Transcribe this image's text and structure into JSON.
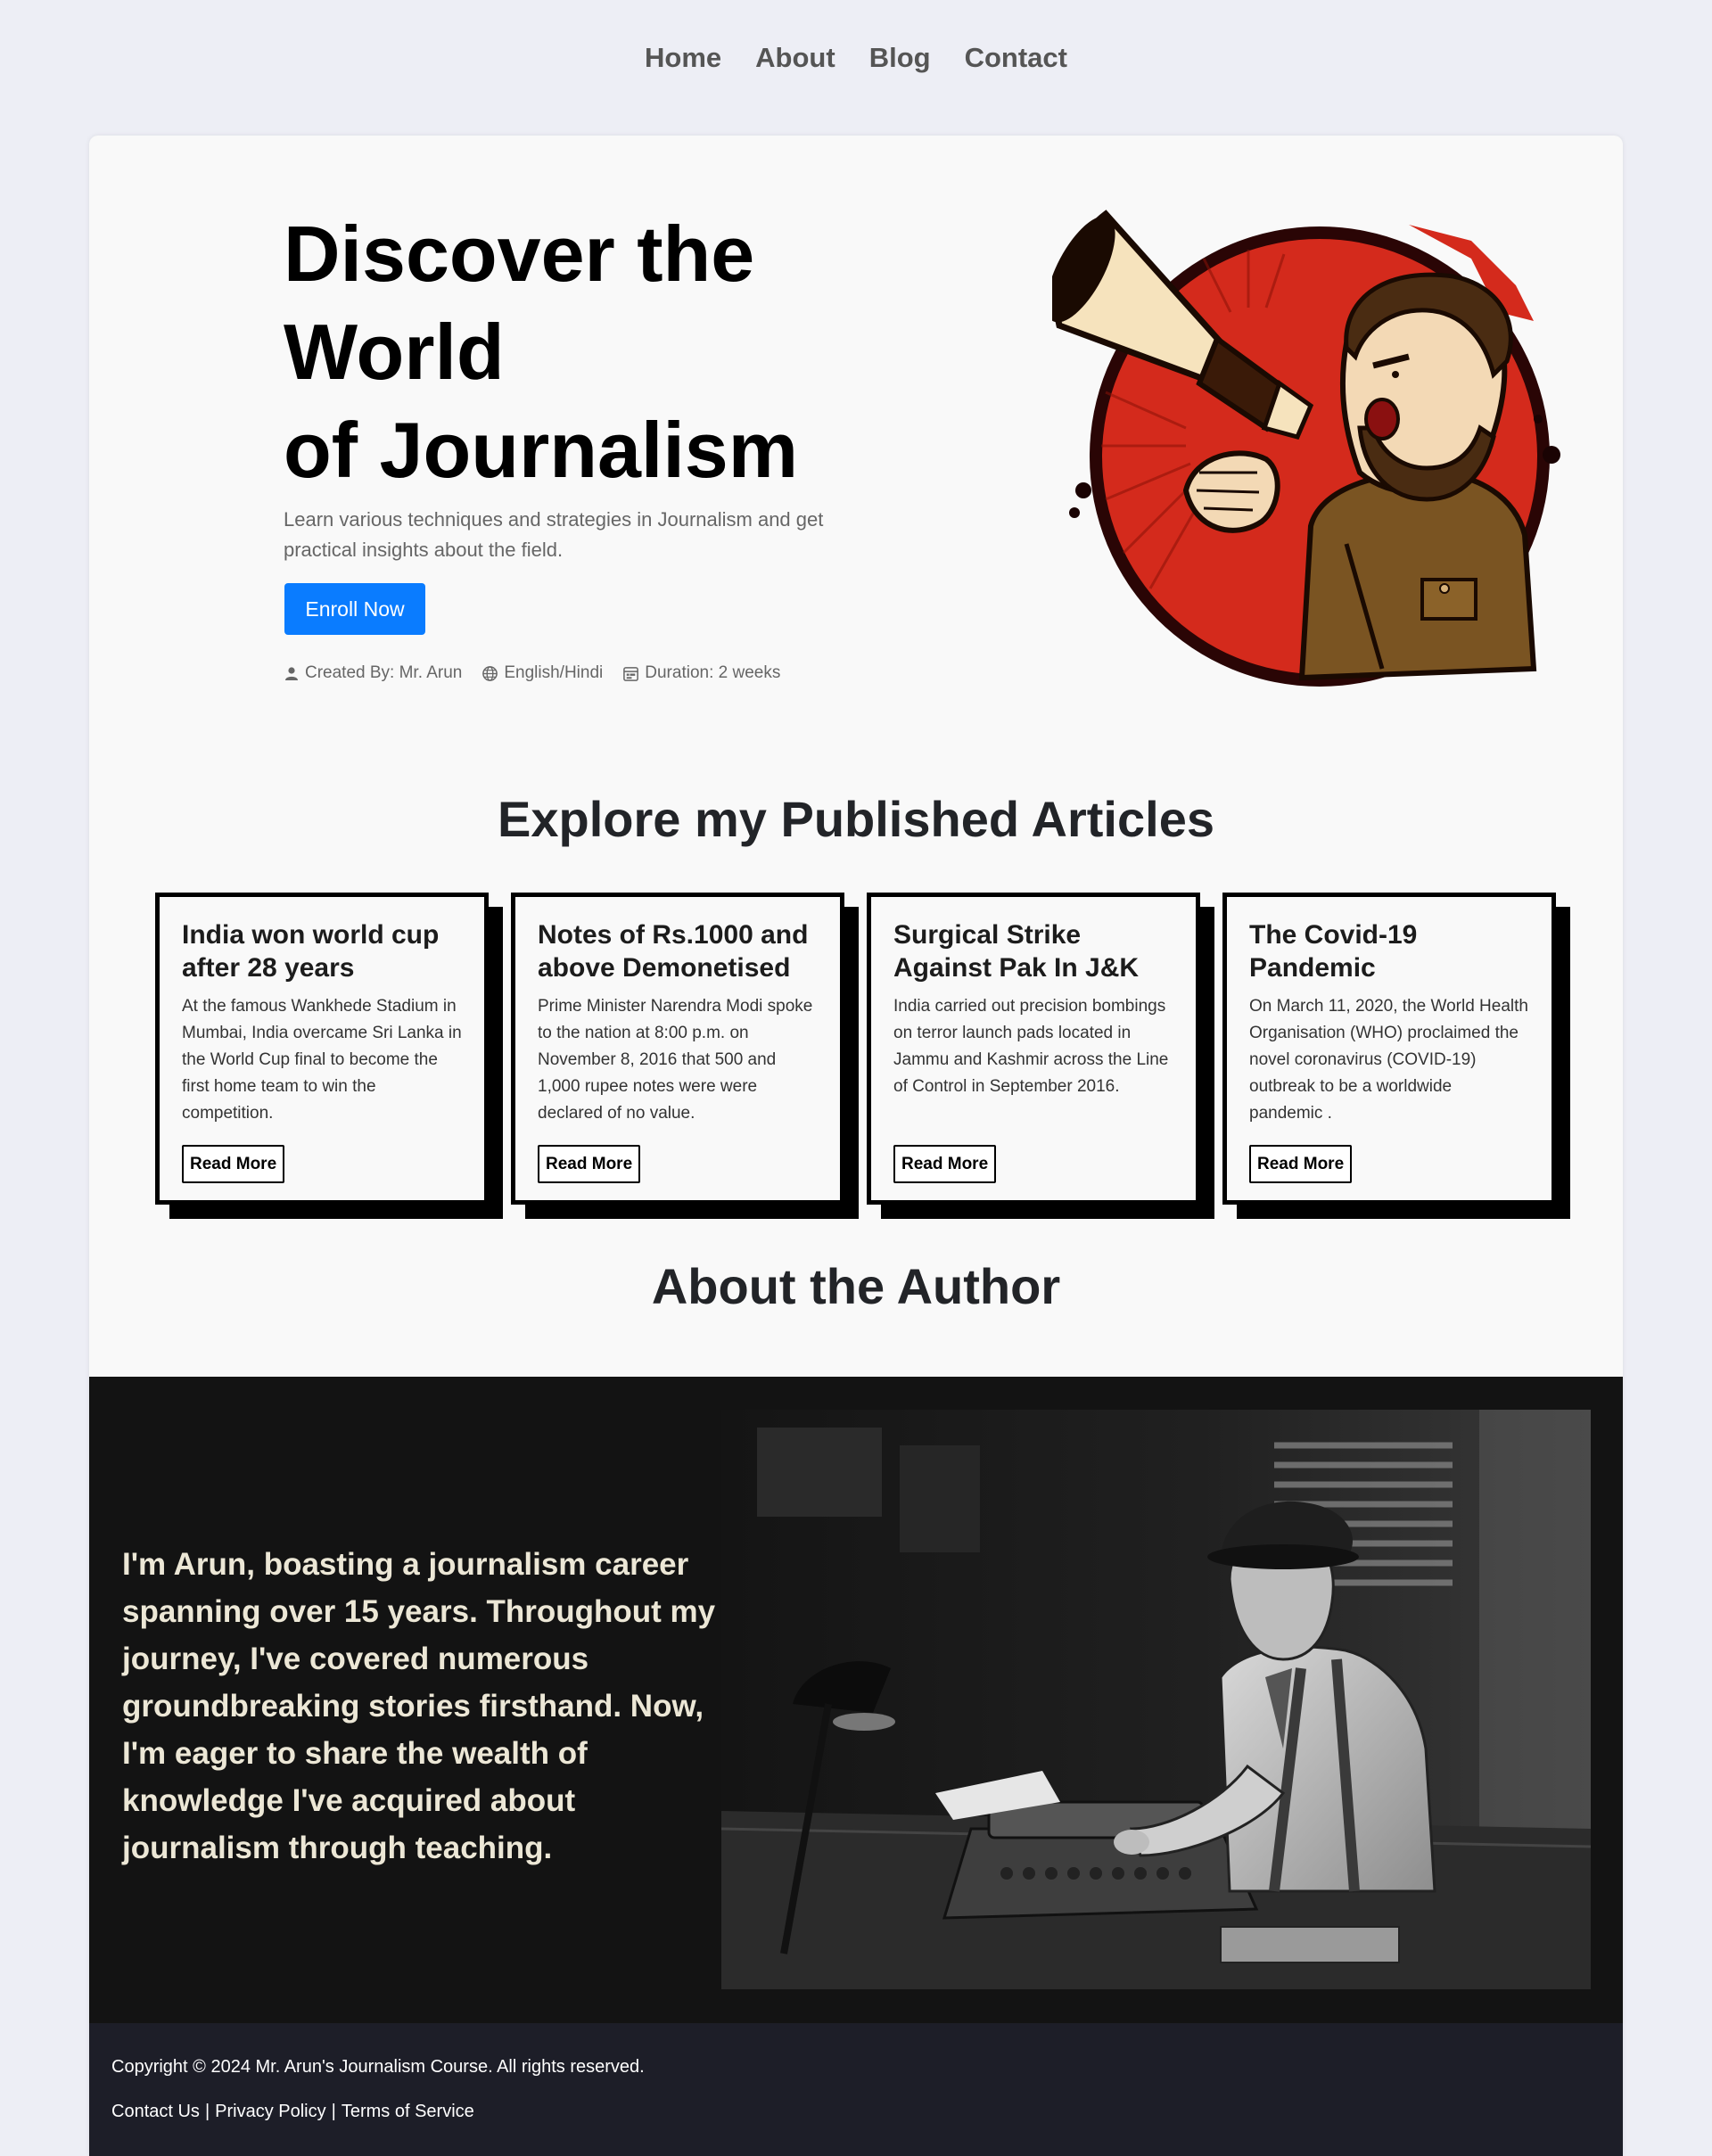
{
  "nav": {
    "items": [
      {
        "label": "Home"
      },
      {
        "label": "About"
      },
      {
        "label": "Blog"
      },
      {
        "label": "Contact"
      }
    ]
  },
  "hero": {
    "title_lines": [
      "Discover the",
      "World",
      "of Journalism"
    ],
    "subtitle": "Learn various techniques and strategies in Journalism and get practical insights about the field.",
    "cta_label": "Enroll Now",
    "meta": {
      "created_by": "Created By: Mr. Arun",
      "language": "English/Hindi",
      "duration": "Duration: 2 weeks"
    },
    "illustration_icon": "megaphone-shouting-man-illustration"
  },
  "articles": {
    "heading": "Explore my Published Articles",
    "items": [
      {
        "title": "India won world cup after 28 years",
        "summary": "At the famous Wankhede Stadium in Mumbai, India overcame Sri Lanka in the World Cup final to become the first home team to win the competition.",
        "button": "Read More"
      },
      {
        "title": "Notes of Rs.1000 and above Demonetised",
        "summary": "Prime Minister Narendra Modi spoke to the nation at 8:00 p.m. on November 8, 2016 that 500 and 1,000 rupee notes were were declared of no value.",
        "button": "Read More"
      },
      {
        "title": "Surgical Strike Against Pak In J&K",
        "summary": "India carried out precision bombings on terror launch pads located in Jammu and Kashmir across the Line of Control in September 2016.",
        "button": "Read More"
      },
      {
        "title": "The Covid-19 Pandemic",
        "summary": "On March 11, 2020, the World Health Organisation (WHO) proclaimed the novel coronavirus (COVID-19) outbreak to be a worldwide pandemic .",
        "button": "Read More"
      }
    ]
  },
  "author": {
    "heading": "About the Author",
    "bio": "I'm Arun, boasting a journalism career spanning over 15 years. Throughout my journey, I've covered numerous groundbreaking stories firsthand. Now, I'm eager to share the wealth of knowledge I've acquired about journalism through teaching.",
    "photo_icon": "journalist-at-typewriter-photo"
  },
  "footer": {
    "copyright": "Copyright © 2024 Mr. Arun's Journalism Course. All rights reserved.",
    "links": [
      {
        "label": "Contact Us"
      },
      {
        "label": "Privacy Policy"
      },
      {
        "label": "Terms of Service"
      }
    ],
    "separator": "|"
  },
  "colors": {
    "page_bg": "#edeef5",
    "card_bg": "#f9f9f9",
    "accent": "#0a7cff",
    "dark_section": "#131313",
    "footer_bg": "#1d1e28",
    "illustration_red": "#d42a1c"
  }
}
